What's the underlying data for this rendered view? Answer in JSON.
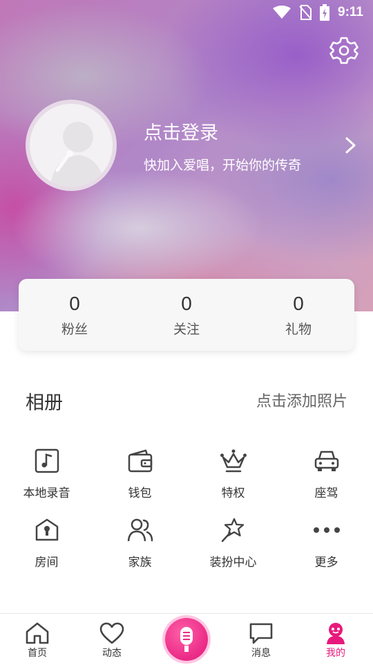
{
  "status_bar": {
    "time": "9:11"
  },
  "profile": {
    "login_title": "点击登录",
    "login_subtitle": "快加入爱唱，开始你的传奇"
  },
  "stats": [
    {
      "value": "0",
      "label": "粉丝"
    },
    {
      "value": "0",
      "label": "关注"
    },
    {
      "value": "0",
      "label": "礼物"
    }
  ],
  "album": {
    "title": "相册",
    "add_label": "点击添加照片"
  },
  "grid": [
    {
      "label": "本地录音",
      "icon": "music-note-icon"
    },
    {
      "label": "钱包",
      "icon": "wallet-icon"
    },
    {
      "label": "特权",
      "icon": "crown-icon"
    },
    {
      "label": "座驾",
      "icon": "car-icon"
    },
    {
      "label": "房间",
      "icon": "house-icon"
    },
    {
      "label": "家族",
      "icon": "family-icon"
    },
    {
      "label": "装扮中心",
      "icon": "star-wand-icon"
    },
    {
      "label": "更多",
      "icon": "more-dots-icon"
    }
  ],
  "bottom_nav": {
    "items": [
      {
        "label": "首页",
        "icon": "home-icon"
      },
      {
        "label": "动态",
        "icon": "heart-icon"
      },
      {
        "label": "",
        "icon": "microphone-icon"
      },
      {
        "label": "消息",
        "icon": "chat-icon"
      },
      {
        "label": "我的",
        "icon": "profile-icon"
      }
    ],
    "active": "我的"
  },
  "colors": {
    "accent": "#e8197c",
    "text": "#333333"
  }
}
